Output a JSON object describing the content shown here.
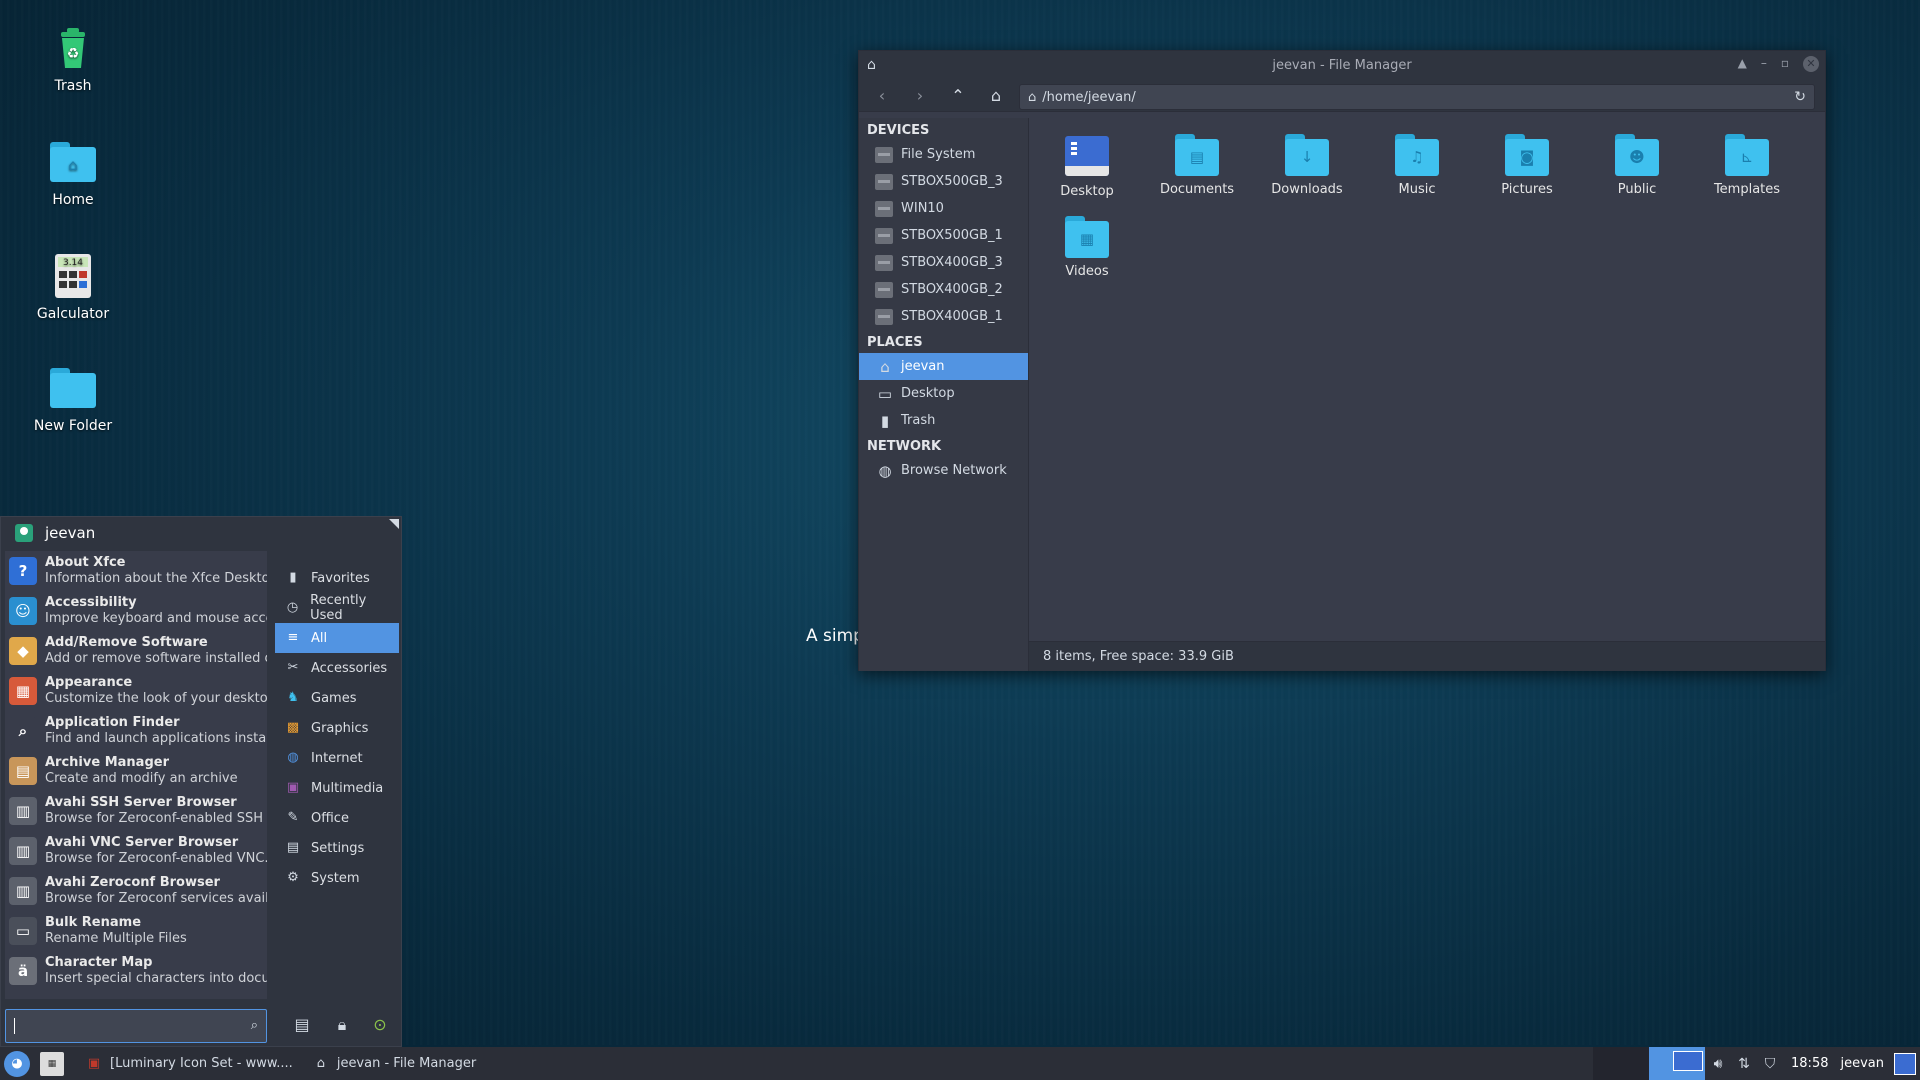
{
  "desktop": {
    "icons": [
      {
        "label": "Trash",
        "icon": "trash-icon"
      },
      {
        "label": "Home",
        "icon": "home-folder-icon"
      },
      {
        "label": "Galculator",
        "icon": "calculator-icon",
        "badge": "3.14"
      },
      {
        "label": "New Folder",
        "icon": "folder-icon"
      }
    ],
    "background_text": "A simp"
  },
  "file_manager": {
    "title": "jeevan - File Manager",
    "path": "/home/jeevan/",
    "sidebar": {
      "devices_heading": "DEVICES",
      "devices": [
        "File System",
        "STBOX500GB_3",
        "WIN10",
        "STBOX500GB_1",
        "STBOX400GB_3",
        "STBOX400GB_2",
        "STBOX400GB_1"
      ],
      "places_heading": "PLACES",
      "places": [
        "jeevan",
        "Desktop",
        "Trash"
      ],
      "network_heading": "NETWORK",
      "network": [
        "Browse Network"
      ]
    },
    "files": [
      {
        "name": "Desktop",
        "icon": "desktop-folder-icon"
      },
      {
        "name": "Documents",
        "icon": "documents-folder-icon"
      },
      {
        "name": "Downloads",
        "icon": "downloads-folder-icon"
      },
      {
        "name": "Music",
        "icon": "music-folder-icon"
      },
      {
        "name": "Pictures",
        "icon": "pictures-folder-icon"
      },
      {
        "name": "Public",
        "icon": "public-folder-icon"
      },
      {
        "name": "Templates",
        "icon": "templates-folder-icon"
      },
      {
        "name": "Videos",
        "icon": "videos-folder-icon"
      }
    ],
    "status": "8 items, Free space: 33.9 GiB"
  },
  "menu": {
    "user": "jeevan",
    "apps": [
      {
        "name": "About Xfce",
        "desc": "Information about the Xfce Deskto...",
        "color": "#2f6fd6",
        "glyph": "?"
      },
      {
        "name": "Accessibility",
        "desc": "Improve keyboard and mouse acces...",
        "color": "#2a8fd0",
        "glyph": "☺"
      },
      {
        "name": "Add/Remove Software",
        "desc": "Add or remove software installed o...",
        "color": "#e0a84a",
        "glyph": "◆"
      },
      {
        "name": "Appearance",
        "desc": "Customize the look of your desktop",
        "color": "#d75a3a",
        "glyph": "▦"
      },
      {
        "name": "Application Finder",
        "desc": "Find and launch applications install...",
        "color": "#383c4a",
        "glyph": "⌕"
      },
      {
        "name": "Archive Manager",
        "desc": "Create and modify an archive",
        "color": "#c8965a",
        "glyph": "▤"
      },
      {
        "name": "Avahi SSH Server Browser",
        "desc": "Browse for Zeroconf-enabled SSH ...",
        "color": "#5c616c",
        "glyph": "▥"
      },
      {
        "name": "Avahi VNC Server Browser",
        "desc": "Browse for Zeroconf-enabled VNC...",
        "color": "#5c616c",
        "glyph": "▥"
      },
      {
        "name": "Avahi Zeroconf Browser",
        "desc": "Browse for Zeroconf services availa...",
        "color": "#5c616c",
        "glyph": "▥"
      },
      {
        "name": "Bulk Rename",
        "desc": "Rename Multiple Files",
        "color": "#4a4f5a",
        "glyph": "▭"
      },
      {
        "name": "Character Map",
        "desc": "Insert special characters into docu...",
        "color": "#6b6f78",
        "glyph": "ä"
      }
    ],
    "categories": [
      {
        "label": "Favorites",
        "icon": "bookmark-icon",
        "glyph": "▮",
        "color": "#d3dae3"
      },
      {
        "label": "Recently Used",
        "icon": "clock-icon",
        "glyph": "◷",
        "color": "#d3dae3"
      },
      {
        "label": "All",
        "icon": "list-icon",
        "glyph": "≡",
        "color": "#ffffff"
      },
      {
        "label": "Accessories",
        "icon": "accessories-icon",
        "glyph": "✂",
        "color": "#d3dae3"
      },
      {
        "label": "Games",
        "icon": "games-icon",
        "glyph": "♞",
        "color": "#3fc1ef"
      },
      {
        "label": "Graphics",
        "icon": "graphics-icon",
        "glyph": "▩",
        "color": "#f0a030"
      },
      {
        "label": "Internet",
        "icon": "internet-icon",
        "glyph": "◍",
        "color": "#5294e2"
      },
      {
        "label": "Multimedia",
        "icon": "multimedia-icon",
        "glyph": "▣",
        "color": "#a05ab0"
      },
      {
        "label": "Office",
        "icon": "office-icon",
        "glyph": "✎",
        "color": "#d3dae3"
      },
      {
        "label": "Settings",
        "icon": "settings-icon",
        "glyph": "▤",
        "color": "#d3dae3"
      },
      {
        "label": "System",
        "icon": "system-icon",
        "glyph": "⚙",
        "color": "#d3dae3"
      }
    ],
    "selected_category": "All"
  },
  "taskbar": {
    "tasks": [
      {
        "label": "[Luminary Icon Set - www....",
        "icon": "browser-icon"
      },
      {
        "label": "jeevan - File Manager",
        "icon": "home-icon"
      }
    ],
    "clock": "18:58",
    "user": "jeevan"
  },
  "colors": {
    "accent": "#5294e2",
    "folder": "#3fc1ef",
    "panel": "#2f343f"
  }
}
